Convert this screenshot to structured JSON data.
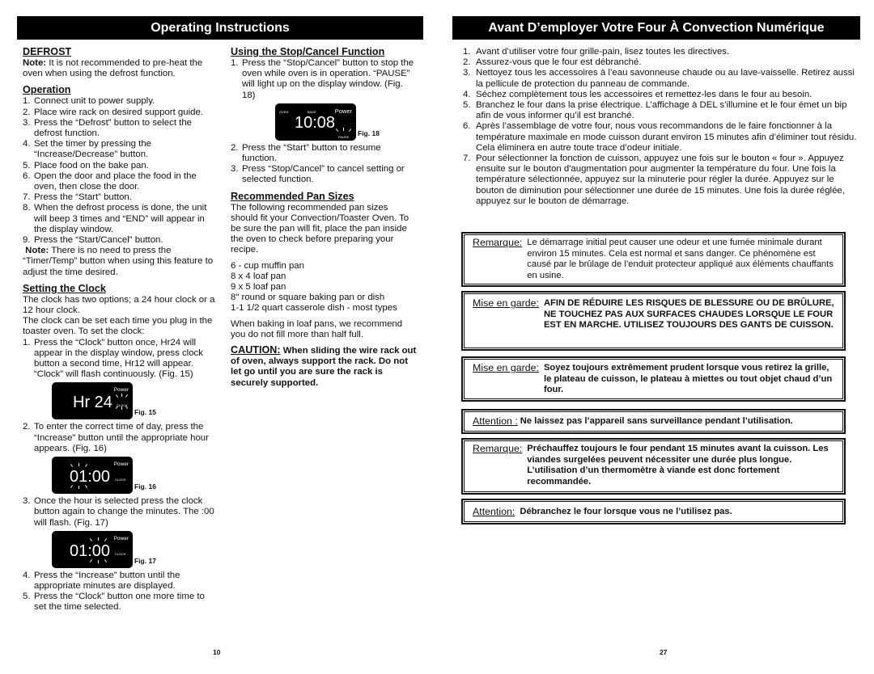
{
  "left_page": {
    "header": "Operating Instructions",
    "defrost": {
      "title": "DEFROST",
      "note_label": "Note:",
      "note_text": " It is not recommended to pre-heat the oven when using the defrost function."
    },
    "operation": {
      "title": "Operation",
      "steps": [
        {
          "n": "1.",
          "text": "Connect unit to power supply."
        },
        {
          "n": "2.",
          "text": "Place wire rack on desired support guide."
        },
        {
          "n": "3.",
          "text": "Press the “Defrost” button to select the defrost function."
        },
        {
          "n": "4.",
          "text": "Set the timer by pressing the “Increase/Decrease” button."
        },
        {
          "n": "5.",
          "text": "Place food on the bake pan."
        },
        {
          "n": "6.",
          "text": "Open the door and place the food in the oven, then close the door."
        },
        {
          "n": "7.",
          "text": "Press the “Start” button."
        },
        {
          "n": "8.",
          "text": "When the defrost process is done, the unit will beep 3 times and “END” will appear in the display window."
        },
        {
          "n": "9.",
          "text": "Press the “Start/Cancel” button."
        }
      ],
      "note_label": "Note:",
      "note_text": " There is no need to press the “Timer/Temp” button when using this feature to adjust the time desired."
    },
    "clock": {
      "title": "Setting the Clock",
      "intro1": "The clock has two options; a 24 hour clock or a 12 hour clock.",
      "intro2": "The clock can be set each time you plug in the toaster oven. To set the clock:",
      "steps": [
        {
          "n": "1.",
          "text": "Press the “Clock” button once, Hr24 will appear in the display window, press clock button a second time, Hr12 will appear.  “Clock” will flash continuously. (Fig. 15)"
        },
        {
          "n": "2.",
          "text": "To enter the correct time of day, press the “Increase” button until the appropriate hour appears. (Fig. 16)"
        },
        {
          "n": "3.",
          "text": "Once the hour is selected press the clock button again to change the minutes. The :00 will flash. (Fig. 17)"
        },
        {
          "n": "4.",
          "text": "Press the “Increase” button until the appropriate minutes are displayed."
        },
        {
          "n": "5.",
          "text": "Press the “Clock” button one more time to set the time selected."
        }
      ],
      "figures": [
        {
          "label": "Fig. 15",
          "display": "Hr 24",
          "power": "Power",
          "clock": "CLOCK"
        },
        {
          "label": "Fig. 16",
          "display": "01:00",
          "power": "Power",
          "clock": "CLOCK"
        },
        {
          "label": "Fig. 17",
          "display": "01:00",
          "power": "Power",
          "clock": "CLOCK"
        }
      ]
    },
    "stop_cancel": {
      "title": "Using the Stop/Cancel Function",
      "steps": [
        {
          "n": "1.",
          "text": "Press the “Stop/Cancel” button to stop the oven while oven is in operation. “PAUSE” will light up on the display window. (Fig. 18)"
        },
        {
          "n": "2.",
          "text": "Press the “Start” button to resume function."
        },
        {
          "n": "3.",
          "text": "Press “Stop/Cancel” to cancel setting or selected function."
        }
      ],
      "figure": {
        "label": "Fig. 18",
        "display": "10:08",
        "oven": "OVEN",
        "bake": "BAKE",
        "power": "Power",
        "pause": "PAUSE"
      }
    },
    "pan_sizes": {
      "title": "Recommended Pan Sizes",
      "intro": "The following recommended pan sizes should fit your Convection/Toaster Oven. To be sure the pan will fit, place the pan inside the oven to check before preparing your recipe.",
      "items": [
        "6 - cup muffin pan",
        "8 x 4 loaf pan",
        "9 x 5 loaf pan",
        "8\"  round or square baking pan or dish",
        "1-1 1/2 quart casserole dish - most types"
      ],
      "loaf_note": "When baking in loaf pans, we recommend you do not fill more than half full.",
      "caution_label": "CAUTION:",
      "caution_text": "  When sliding the wire rack out of oven, always support the rack.  Do not let go until you are sure the rack is securely supported."
    },
    "page_number": "10"
  },
  "right_page": {
    "header": "Avant D’employer Votre Four À Convection Numérique",
    "steps": [
      {
        "n": "1.",
        "text": "Avant d’utiliser votre four grille-pain, lisez toutes les directives."
      },
      {
        "n": "2.",
        "text": "Assurez-vous que le four est débranché."
      },
      {
        "n": "3.",
        "text": "Nettoyez tous les accessoires à l’eau savonneuse chaude ou au lave-vaisselle. Retirez aussi la pellicule de protection du panneau de commande."
      },
      {
        "n": "4.",
        "text": "Séchez complètement tous les accessoires et remettez-les dans le four au besoin."
      },
      {
        "n": "5.",
        "text": "Branchez le four dans la prise électrique. L’affichage à DEL s’illumine et le four émet un bip afin de vous informer qu’il est branché."
      },
      {
        "n": "6.",
        "text": "Après l’assemblage de votre four, nous vous recommandons de le faire fonctionner à la température maximale en mode cuisson durant environ 15 minutes afin d’éliminer tout résidu. Cela éliminera en autre toute trace d’odeur initiale."
      },
      {
        "n": "7.",
        "text": "Pour sélectionner la fonction de cuisson, appuyez une fois sur le bouton « four ». Appuyez ensuite sur le bouton d'augmentation pour augmenter la température du four.  Une fois la température sélectionnée, appuyez sur la minuterie pour régler la durée.  Appuyez sur le bouton de diminution pour sélectionner une durée de 15 minutes.  Une fois la durée réglée, appuyez sur le bouton de démarrage."
      }
    ],
    "boxes": [
      {
        "label": "Remarque:",
        "text": "Le démarrage initial peut causer une odeur et une fumée minimale durant environ 15 minutes.  Cela est normal et sans danger.  Ce phénomène est causé par le brûlage de l’enduit protecteur appliqué aux éléments chauffants en usine.",
        "bold": false
      },
      {
        "label": "Mise en garde:",
        "text": "AFIN DE RÉDUIRE LES RISQUES DE BLESSURE OU DE BRÛLURE, NE TOUCHEZ PAS AUX SURFACES CHAUDES LORSQUE LE FOUR EST EN MARCHE.  UTILISEZ TOUJOURS DES GANTS DE CUISSON.",
        "bold": true
      },
      {
        "label": "Mise en garde:",
        "text": "Soyez toujours extrêmement prudent lorsque vous retirez la grille, le plateau de cuisson, le plateau à miettes ou tout objet chaud d’un four.",
        "bold": true
      },
      {
        "label": "Attention :",
        "text": "Ne laissez pas l’appareil sans surveillance pendant l’utilisation.",
        "bold": true
      },
      {
        "label": "Remarque:",
        "text": "Préchauffez toujours le four pendant 15 minutes avant la cuisson. Les viandes surgelées peuvent nécessiter une durée plus longue.  L’utilisation d’un thermomètre à viande est donc fortement recommandée.",
        "bold": true
      },
      {
        "label": "Attention:",
        "text": "Débranchez le four lorsque vous ne l’utilisez pas.",
        "bold": true
      }
    ],
    "page_number": "27"
  }
}
